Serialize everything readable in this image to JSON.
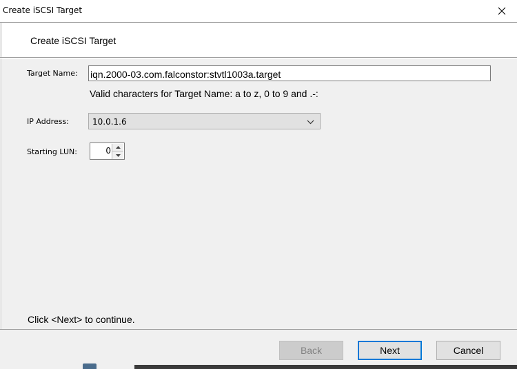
{
  "window": {
    "title": "Create iSCSI Target",
    "close_icon": "close-icon"
  },
  "header": {
    "title": "Create iSCSI Target"
  },
  "form": {
    "target_name_label": "Target Name:",
    "target_name_value": "iqn.2000-03.com.falconstor:stvtl1003a.target",
    "target_name_hint": "Valid characters for Target Name: a to z, 0 to 9 and .-:",
    "ip_label": "IP Address:",
    "ip_value": "10.0.1.6",
    "lun_label": "Starting LUN:",
    "lun_value": "0",
    "footer_note": "Click <Next> to continue."
  },
  "buttons": {
    "back": "Back",
    "next": "Next",
    "cancel": "Cancel"
  },
  "colors": {
    "accent_border": "#0078d7",
    "panel_bg": "#f0f0f0",
    "disabled_text": "#838383"
  }
}
